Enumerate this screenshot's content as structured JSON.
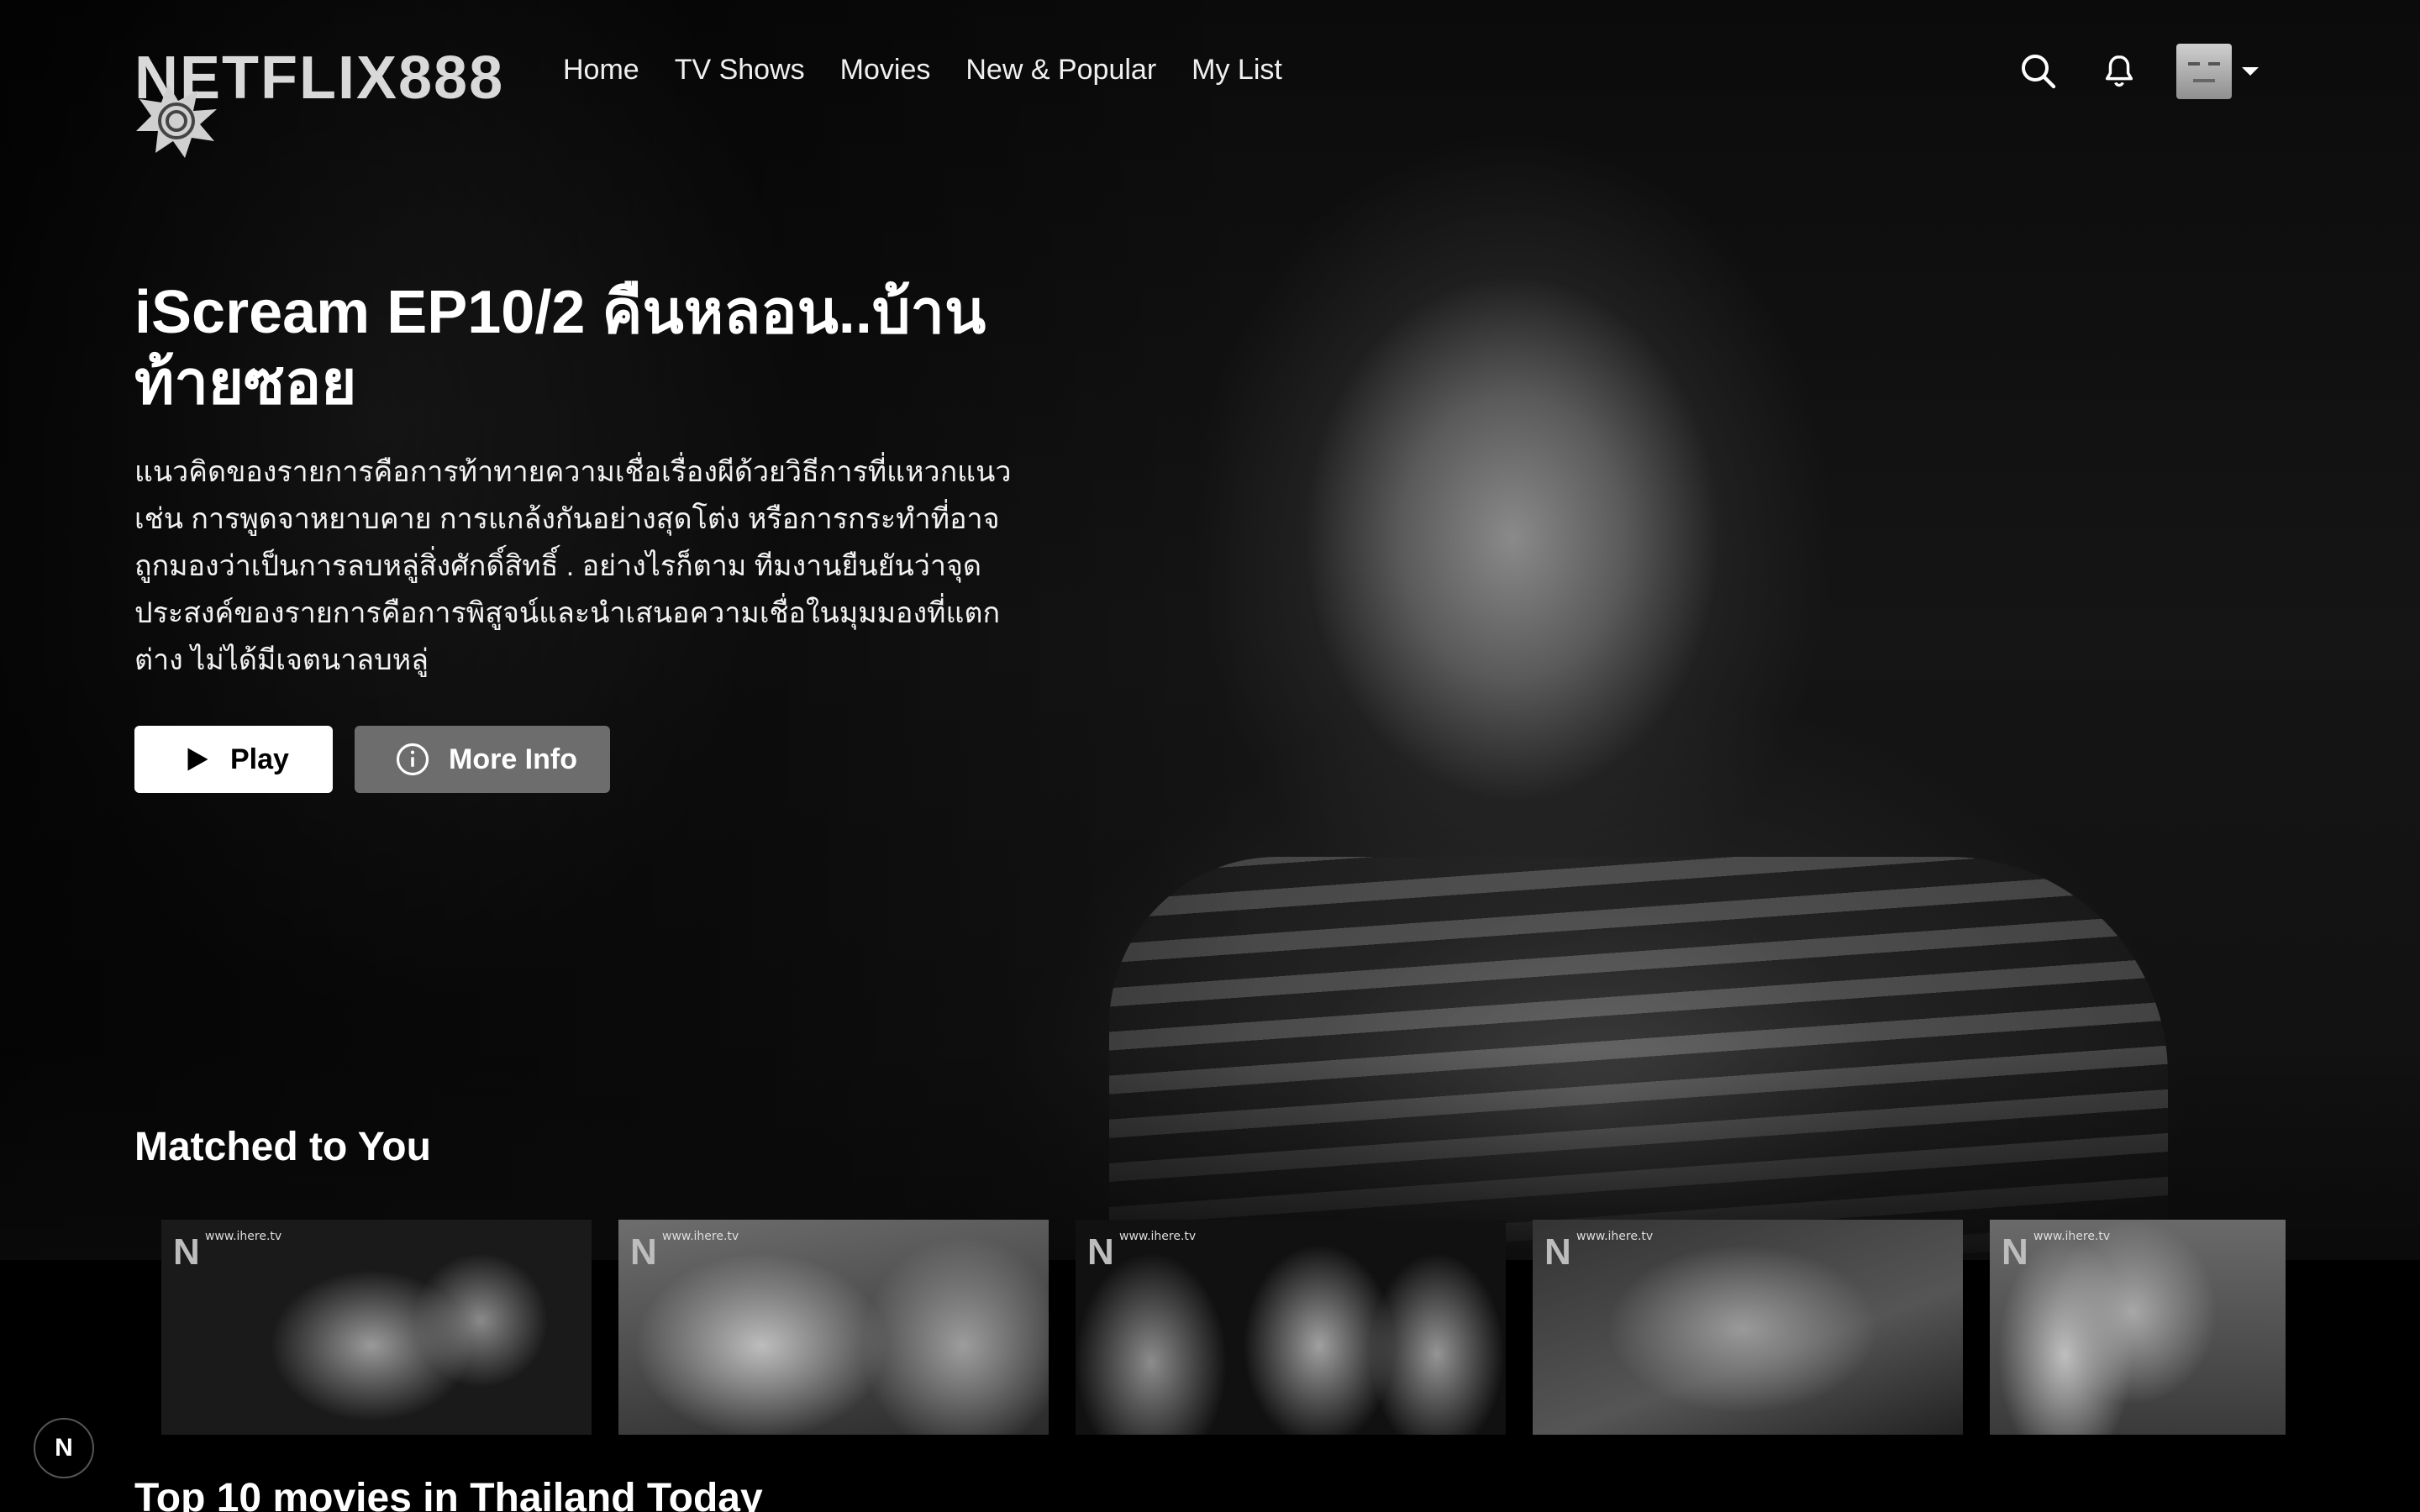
{
  "app": {
    "logo_text": "NETFLIX888"
  },
  "nav": {
    "links": [
      "Home",
      "TV Shows",
      "Movies",
      "New & Popular",
      "My List"
    ]
  },
  "header_icons": {
    "search": "search-icon",
    "notifications": "bell-icon",
    "profile_menu": "chevron-down-icon"
  },
  "hero": {
    "title": "iScream EP10/2 คืนหลอน..บ้านท้ายซอย",
    "description": "แนวคิดของรายการคือการท้าทายความเชื่อเรื่องผีด้วยวิธีการที่แหวกแนว เช่น การพูดจาหยาบคาย การแกล้งกันอย่างสุดโต่ง หรือการกระทำที่อาจถูกมองว่าเป็นการลบหลู่สิ่งศักดิ์สิทธิ์ . อย่างไรก็ตาม ทีมงานยืนยันว่าจุดประสงค์ของรายการคือการพิสูจน์และนำเสนอความเชื่อในมุมมองที่แตกต่าง ไม่ได้มีเจตนาลบหลู่",
    "play_label": "Play",
    "info_label": "More Info"
  },
  "rows": [
    {
      "title": "Matched to You",
      "items": [
        {
          "badge": "N",
          "watermark": "www.ihere.tv"
        },
        {
          "badge": "N",
          "watermark": "www.ihere.tv"
        },
        {
          "badge": "N",
          "watermark": "www.ihere.tv"
        },
        {
          "badge": "N",
          "watermark": "www.ihere.tv"
        },
        {
          "badge": "N",
          "watermark": "www.ihere.tv"
        }
      ]
    },
    {
      "title": "Top 10 movies in Thailand Today"
    }
  ],
  "corner_badge": "N",
  "colors": {
    "background": "#141414",
    "play_button": "#ffffff",
    "info_button": "#6d6d6d"
  }
}
